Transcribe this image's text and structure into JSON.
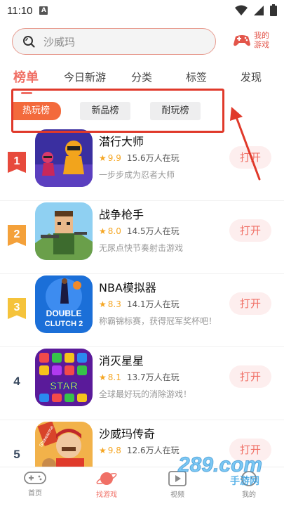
{
  "status_bar": {
    "time": "11:10",
    "a_label": "A"
  },
  "search": {
    "placeholder": "沙威玛"
  },
  "my_games": {
    "label": "我的游戏"
  },
  "top_tabs": [
    {
      "label": "榜单",
      "active": true
    },
    {
      "label": "今日新游"
    },
    {
      "label": "分类"
    },
    {
      "label": "标签"
    },
    {
      "label": "发现"
    }
  ],
  "sub_tabs": [
    {
      "label": "热玩榜",
      "active": true
    },
    {
      "label": "新品榜"
    },
    {
      "label": "耐玩榜"
    }
  ],
  "open_label": "打开",
  "games": [
    {
      "rank": "1",
      "name": "潜行大师",
      "score": "9.9",
      "players": "15.6万人在玩",
      "desc": "一步步成为忍者大师"
    },
    {
      "rank": "2",
      "name": "战争枪手",
      "score": "8.0",
      "players": "14.5万人在玩",
      "desc": "无尿点快节奏射击游戏"
    },
    {
      "rank": "3",
      "name": "NBA模拟器",
      "score": "8.3",
      "players": "14.1万人在玩",
      "desc": "称霸锦标赛，获得冠军奖杯吧！"
    },
    {
      "rank": "4",
      "name": "消灭星星",
      "score": "8.1",
      "players": "13.7万人在玩",
      "desc": "全球最好玩的消除游戏！"
    },
    {
      "rank": "5",
      "name": "沙威玛传奇",
      "score": "9.8",
      "players": "12.6万人在玩",
      "desc": ""
    }
  ],
  "icon_text": {
    "double_clutch_1": "DOUBLE",
    "double_clutch_2": "CLUTCH 2",
    "star": "STAR",
    "shawarma": "Shawarma"
  },
  "bottom_nav": [
    {
      "label": "首页"
    },
    {
      "label": "找游戏",
      "active": true
    },
    {
      "label": "视频"
    },
    {
      "label": "我的"
    }
  ],
  "watermark": {
    "text": "289.com",
    "sub": "手游网"
  },
  "colors": {
    "accent": "#f07066",
    "orange": "#f36a3c",
    "annotation_red": "#e0392a"
  }
}
